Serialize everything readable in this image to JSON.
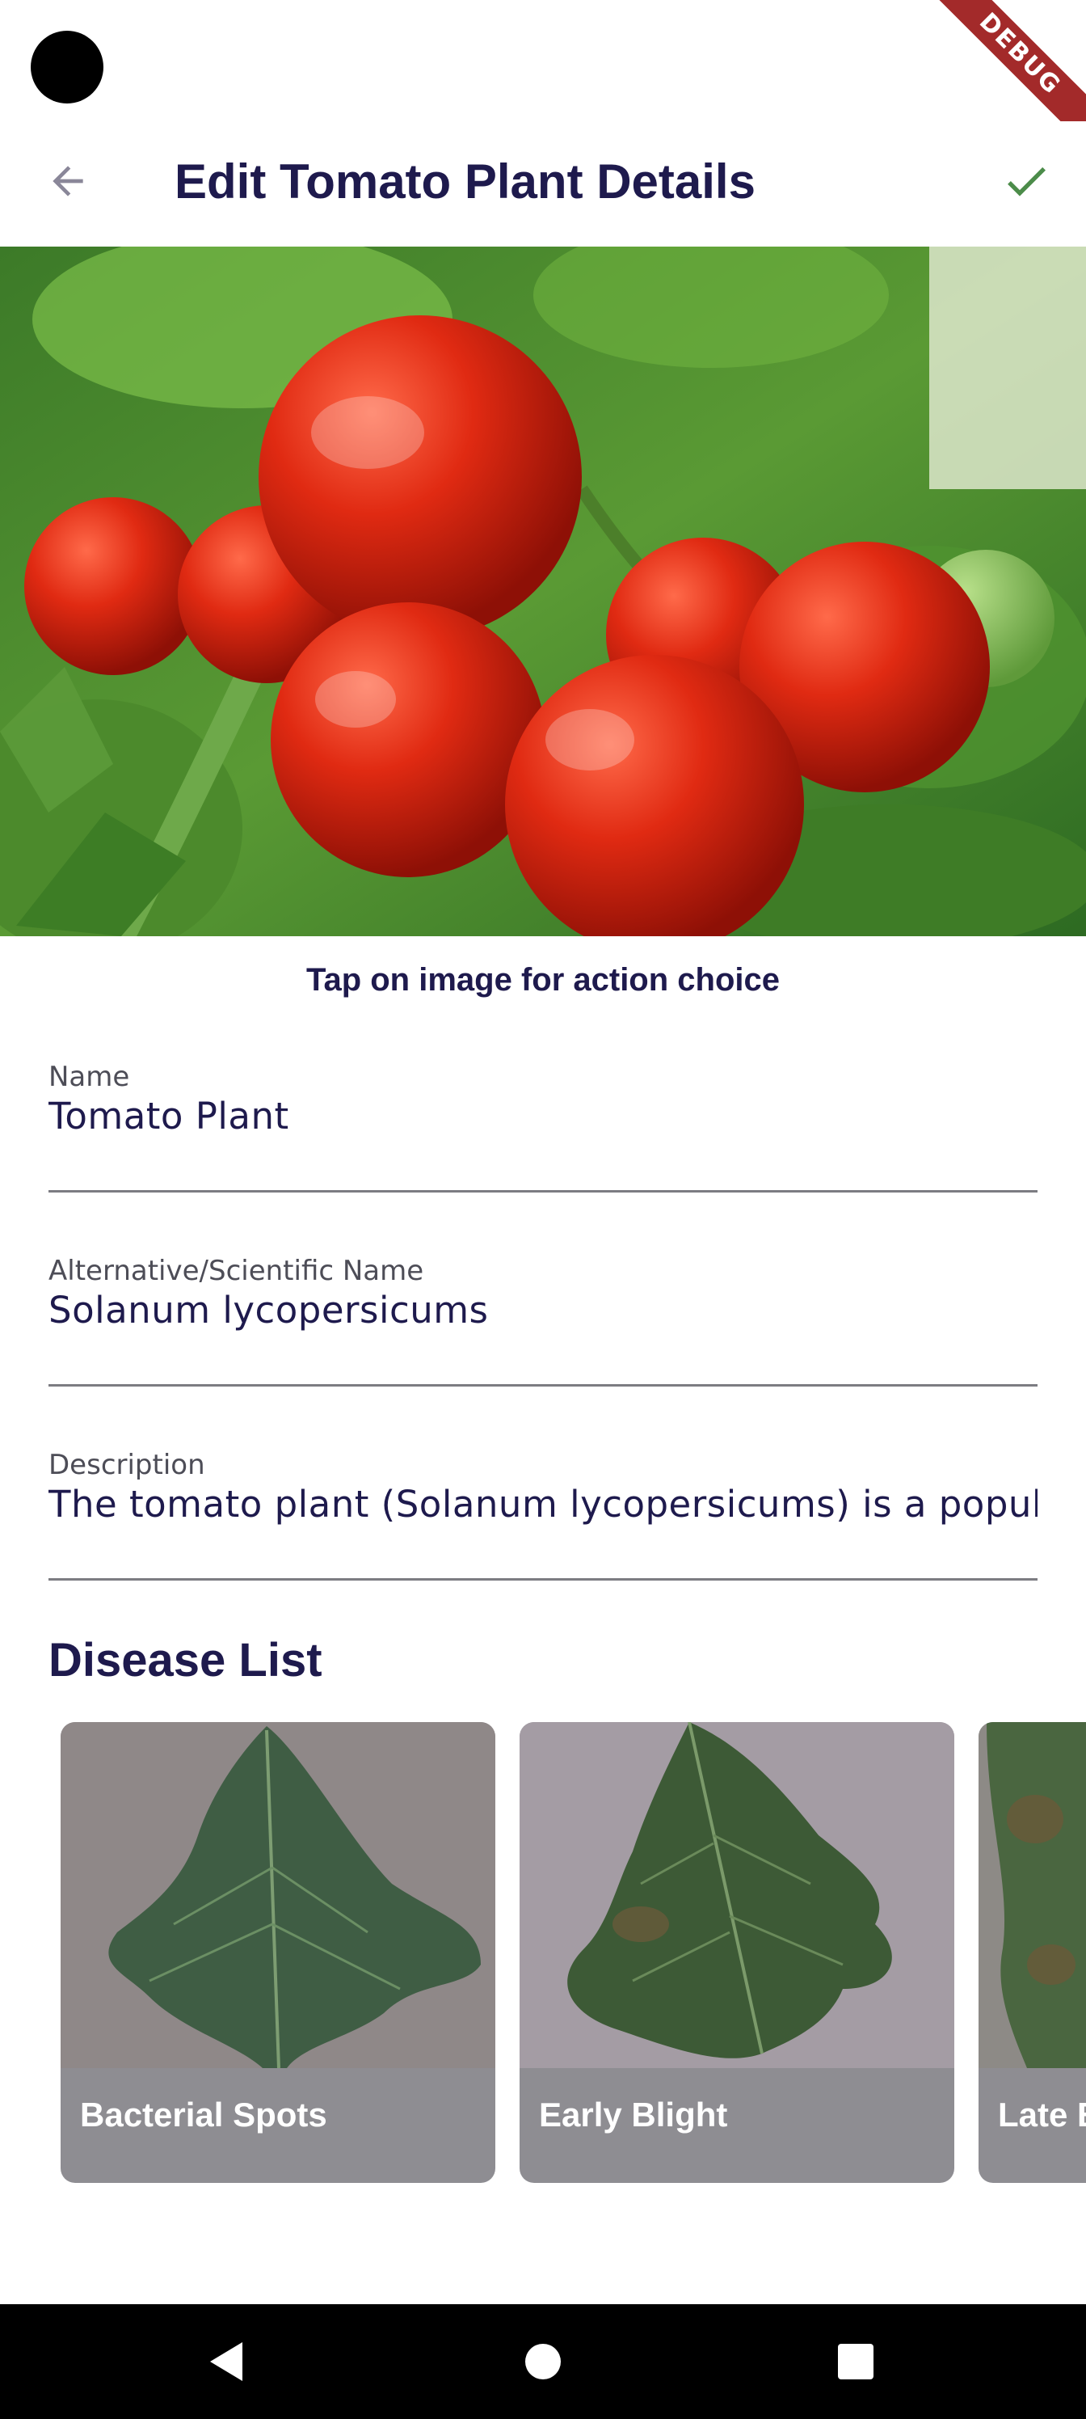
{
  "app_bar": {
    "title": "Edit Tomato Plant Details",
    "back_icon": "arrow-back-icon",
    "save_icon": "check-icon"
  },
  "debug_banner": "DEBUG",
  "hint": "Tap on image for action choice",
  "fields": {
    "name": {
      "label": "Name",
      "value": "Tomato Plant"
    },
    "alt_name": {
      "label": "Alternative/Scientific Name",
      "value": "Solanum lycopersicums"
    },
    "description": {
      "label": "Description",
      "value": "The tomato plant (Solanum lycopersicums) is a popular"
    }
  },
  "disease_section": {
    "title": "Disease List",
    "items": [
      {
        "label": "Bacterial Spots"
      },
      {
        "label": "Early Blight"
      },
      {
        "label": "Late B"
      }
    ]
  },
  "colors": {
    "title": "#1e1a4d",
    "accent_check": "#4c8c4a",
    "card_overlay": "#8e8d92"
  }
}
